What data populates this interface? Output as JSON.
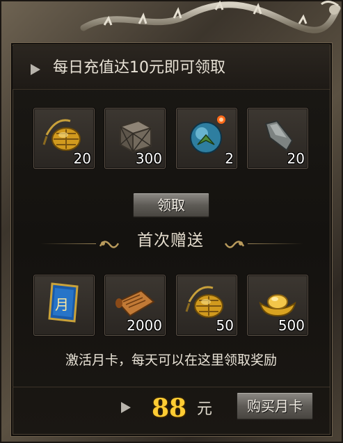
{
  "header": {
    "text": "每日充值达10元即可领取"
  },
  "daily_rewards": [
    {
      "icon": "golden-beetle-icon",
      "qty": "20"
    },
    {
      "icon": "wooden-crate-icon",
      "qty": "300"
    },
    {
      "icon": "blue-orb-icon",
      "qty": "2"
    },
    {
      "icon": "stone-fragment-icon",
      "qty": "20"
    }
  ],
  "claim_button": {
    "label": "领取"
  },
  "first_gift": {
    "title": "首次赠送"
  },
  "first_rewards": [
    {
      "icon": "month-card-icon",
      "qty": "",
      "card_char": "月"
    },
    {
      "icon": "scroll-icon",
      "qty": "2000"
    },
    {
      "icon": "golden-beetle-icon",
      "qty": "50"
    },
    {
      "icon": "gold-ingot-icon",
      "qty": "500"
    }
  ],
  "description": "激活月卡，每天可以在这里领取奖励",
  "purchase": {
    "price": "88",
    "unit": "元",
    "button_label": "购买月卡"
  },
  "colors": {
    "price": "#ffcc33",
    "panel": "#1b1915",
    "frame": "#5b5142"
  }
}
